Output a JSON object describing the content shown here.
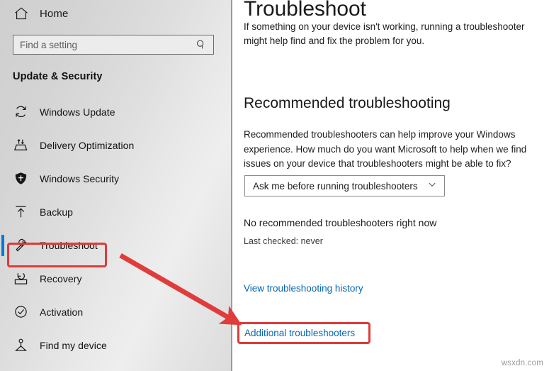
{
  "sidebar": {
    "home": {
      "label": "Home",
      "icon": "home-icon"
    },
    "search": {
      "placeholder": "Find a setting",
      "value": "",
      "icon": "search-icon"
    },
    "section_title": "Update & Security",
    "items": [
      {
        "label": "Windows Update",
        "icon": "refresh-icon",
        "selected": false
      },
      {
        "label": "Delivery Optimization",
        "icon": "download-tray-icon",
        "selected": false
      },
      {
        "label": "Windows Security",
        "icon": "shield-icon",
        "selected": false
      },
      {
        "label": "Backup",
        "icon": "upload-arrow-icon",
        "selected": false
      },
      {
        "label": "Troubleshoot",
        "icon": "wrench-icon",
        "selected": true
      },
      {
        "label": "Recovery",
        "icon": "recovery-icon",
        "selected": false
      },
      {
        "label": "Activation",
        "icon": "check-circle-icon",
        "selected": false
      },
      {
        "label": "Find my device",
        "icon": "person-locate-icon",
        "selected": false
      }
    ]
  },
  "content": {
    "title": "Troubleshoot",
    "intro": "If something on your device isn't working, running a troubleshooter might help find and fix the problem for you.",
    "recommended_heading": "Recommended troubleshooting",
    "recommended_body": "Recommended troubleshooters can help improve your Windows experience. How much do you want Microsoft to help when we find issues on your device that troubleshooters might be able to fix?",
    "dropdown": {
      "selected": "Ask me before running troubleshooters",
      "icon": "chevron-down-icon"
    },
    "status": "No recommended troubleshooters right now",
    "last_checked": "Last checked: never",
    "history_link": "View troubleshooting history",
    "additional_link": "Additional troubleshooters"
  },
  "annotations": {
    "highlight_color": "#dd3b3b",
    "arrow_color": "#e03c3c",
    "accent_color": "#0078d7",
    "link_color": "#0567b5",
    "highlights": [
      "Troubleshoot",
      "Additional troubleshooters"
    ]
  },
  "watermark": "wsxdn.com"
}
